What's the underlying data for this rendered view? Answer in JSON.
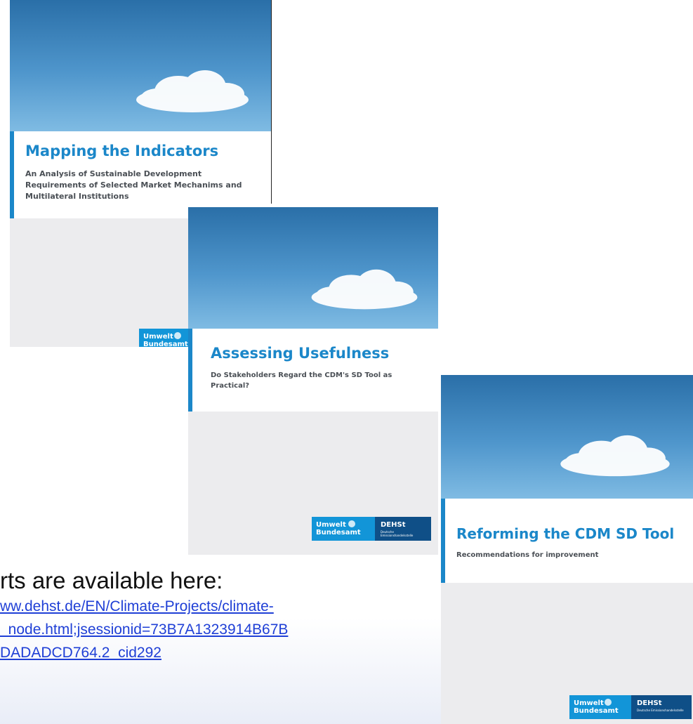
{
  "reports": [
    {
      "title": "Mapping the Indicators",
      "subtitle": "An Analysis of Sustainable Development Requirements of Selected Market Mechanims and Multilateral Institutions",
      "logos": {
        "uba_line1": "Umwelt",
        "uba_line2": "Bundesamt"
      }
    },
    {
      "title": "Assessing Usefulness",
      "subtitle": "Do Stakeholders Regard the CDM's SD Tool as Practical?",
      "logos": {
        "uba_line1": "Umwelt",
        "uba_line2": "Bundesamt",
        "dehst": "DEHSt",
        "dehst_tag": "Deutsche Emissionshandelsstelle"
      }
    },
    {
      "title": "Reforming the CDM SD Tool",
      "subtitle": "Recommendations for improvement",
      "logos": {
        "uba_line1": "Umwelt",
        "uba_line2": "Bundesamt",
        "dehst": "DEHSt",
        "dehst_tag": "Deutsche Emissionshandelsstelle"
      }
    }
  ],
  "caption": {
    "heading": "rts are available here:",
    "link_lines": [
      "ww.dehst.de/EN/Climate-Projects/climate-",
      "_node.html;jsessionid=73B7A1323914B67B",
      "DADADCD764.2_cid292"
    ]
  },
  "colors": {
    "accent": "#1b87c9",
    "sky_top": "#2a6fa8",
    "grey_panel": "#ececee",
    "uba_blue": "#1295d8",
    "dehst_navy": "#0f4f87",
    "link": "#1f3fd6"
  }
}
